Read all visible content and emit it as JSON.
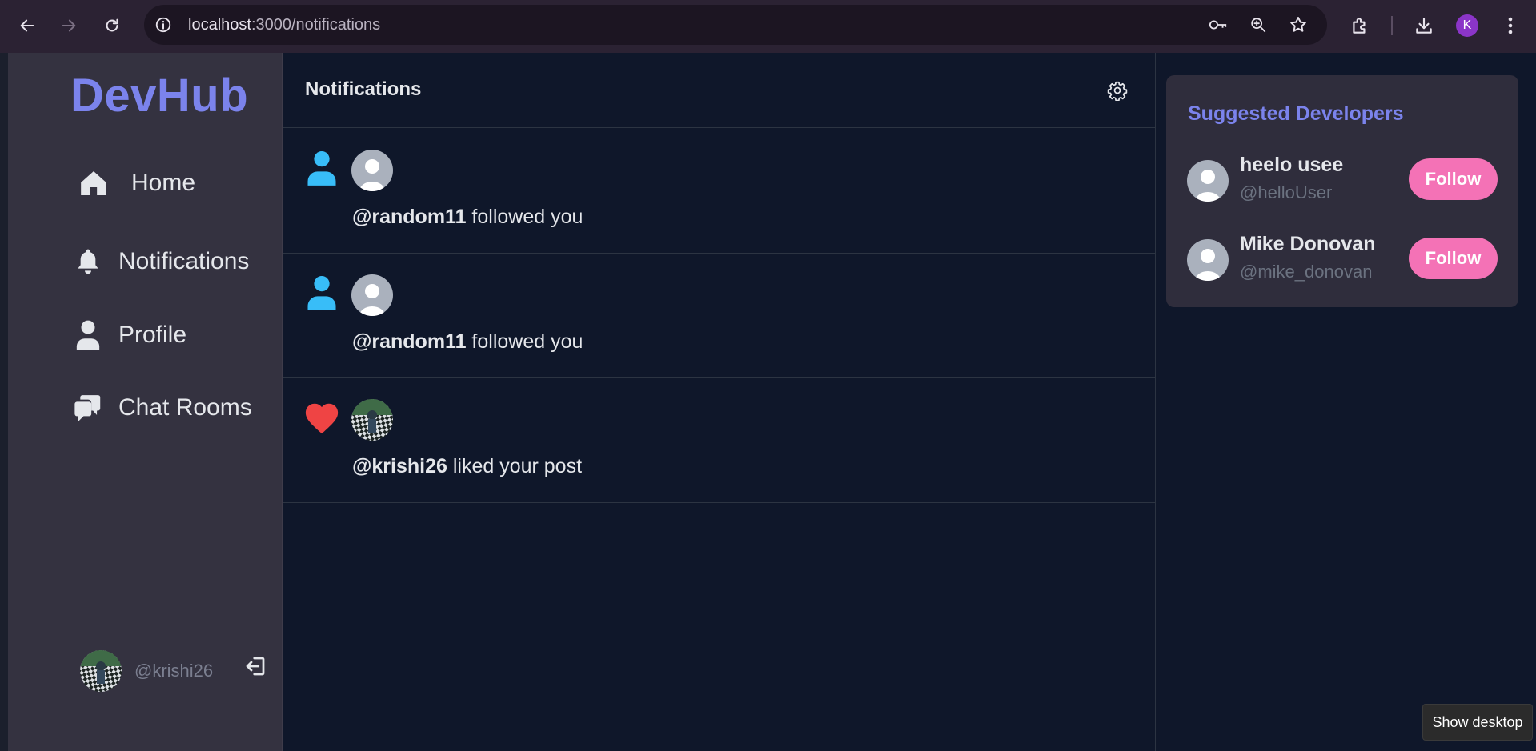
{
  "browser": {
    "url_host": "localhost",
    "url_path": ":3000/notifications",
    "profile_initial": "K",
    "icons": [
      "back-icon",
      "forward-icon",
      "reload-icon",
      "site-info-icon",
      "password-key-icon",
      "zoom-icon",
      "bookmark-star-icon",
      "extensions-icon",
      "download-icon",
      "menu-dots-icon"
    ]
  },
  "sidebar": {
    "logo": "DevHub",
    "items": [
      {
        "label": "Home",
        "icon": "home-icon"
      },
      {
        "label": "Notifications",
        "icon": "bell-icon"
      },
      {
        "label": "Profile",
        "icon": "user-icon"
      },
      {
        "label": "Chat Rooms",
        "icon": "chat-icon"
      }
    ],
    "user": {
      "handle": "@krishi26"
    }
  },
  "main": {
    "title": "Notifications",
    "notifications": [
      {
        "type": "follow",
        "handle": "@random11",
        "text": " followed you"
      },
      {
        "type": "follow",
        "handle": "@random11",
        "text": " followed you"
      },
      {
        "type": "like",
        "handle": "@krishi26",
        "text": " liked your post"
      }
    ]
  },
  "suggestions": {
    "title": "Suggested Developers",
    "users": [
      {
        "name": "heelo usee",
        "handle": "@helloUser",
        "button": "Follow"
      },
      {
        "name": "Mike Donovan",
        "handle": "@mike_donovan",
        "button": "Follow"
      }
    ]
  },
  "tooltip": "Show desktop",
  "colors": {
    "accent": "#7b83ec",
    "follow_button": "#f472b6",
    "follow_icon": "#38bdf8",
    "like_icon": "#ef4444"
  }
}
